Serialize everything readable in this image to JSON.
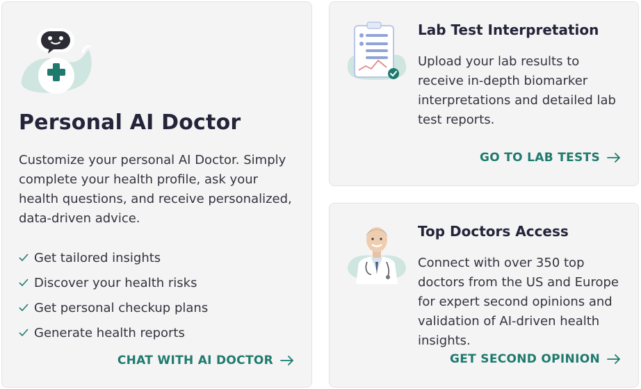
{
  "ai_card": {
    "title": "Personal AI Doctor",
    "description": "Customize your personal AI Doctor. Simply complete your health profile, ask your health questions, and receive personalized, data-driven advice.",
    "features": [
      "Get tailored insights",
      "Discover your health risks",
      "Get personal checkup plans",
      "Generate health reports"
    ],
    "cta": "CHAT WITH AI DOCTOR"
  },
  "lab_card": {
    "title": "Lab Test Interpretation",
    "description": "Upload your lab results to receive in-depth biomarker interpretations and detailed lab test reports.",
    "cta": "GO TO LAB TESTS"
  },
  "doctors_card": {
    "title": "Top Doctors Access",
    "description": "Connect with over 350 top doctors from the US and Europe for expert second opinions and validation of AI-driven health insights.",
    "cta": "GET SECOND OPINION"
  },
  "icons": {
    "menu": "hamburger-menu-icon",
    "robot": "robot-doctor-icon",
    "lab": "lab-report-icon",
    "doctor": "doctor-portrait",
    "check": "check-icon",
    "arrow": "arrow-right-icon"
  },
  "colors": {
    "accent": "#1f7a6e",
    "card_bg": "#f4f4f4",
    "mint": "#cfe6e0"
  }
}
